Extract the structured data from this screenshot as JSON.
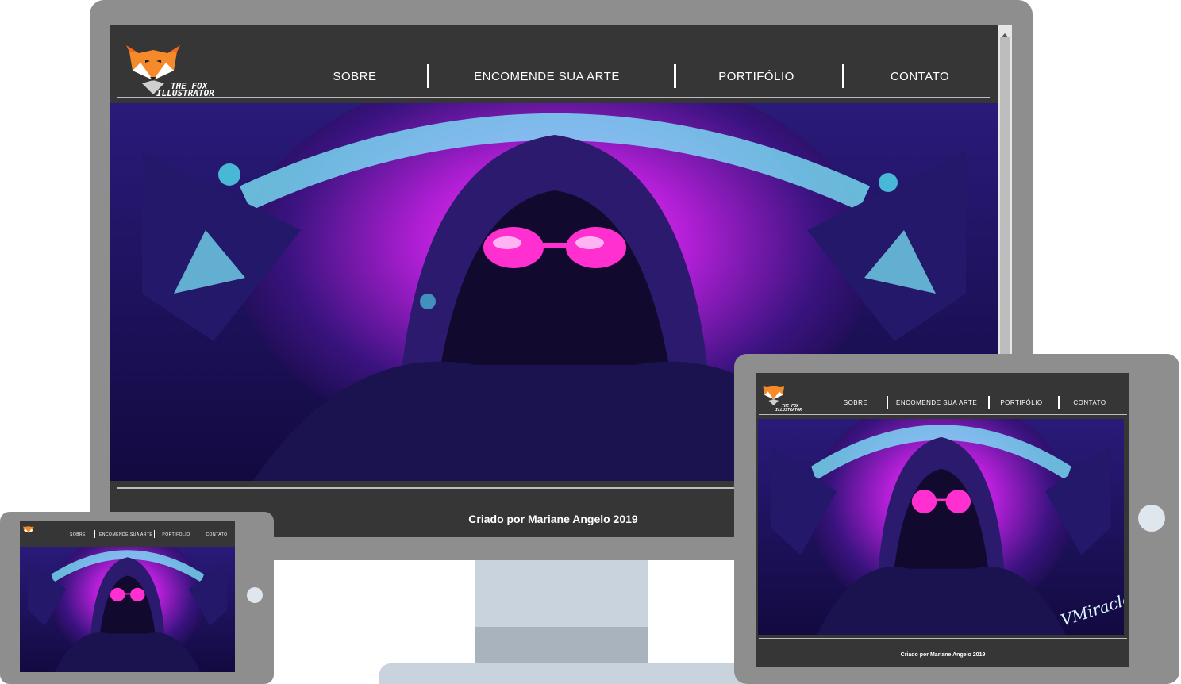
{
  "site": {
    "brand": {
      "line1": "THE FOX",
      "line2": "ILLUSTRATOR"
    },
    "nav": [
      {
        "label": "SOBRE"
      },
      {
        "label": "ENCOMENDE SUA ARTE"
      },
      {
        "label": "PORTIFÓLIO"
      },
      {
        "label": "CONTATO"
      }
    ],
    "footer": "Criado por Mariane Angelo  2019",
    "artwork_signature": "VMiracle"
  },
  "colors": {
    "page_bg": "#363636",
    "frame": "#8e8e8e",
    "stand": "#c9d3de",
    "accent_magenta": "#e040fb",
    "accent_cyan": "#52e0f0",
    "fox_orange": "#f26b1d"
  },
  "icons": [
    "fox-logo-icon",
    "scroll-up-arrow-icon",
    "home-button-icon"
  ]
}
